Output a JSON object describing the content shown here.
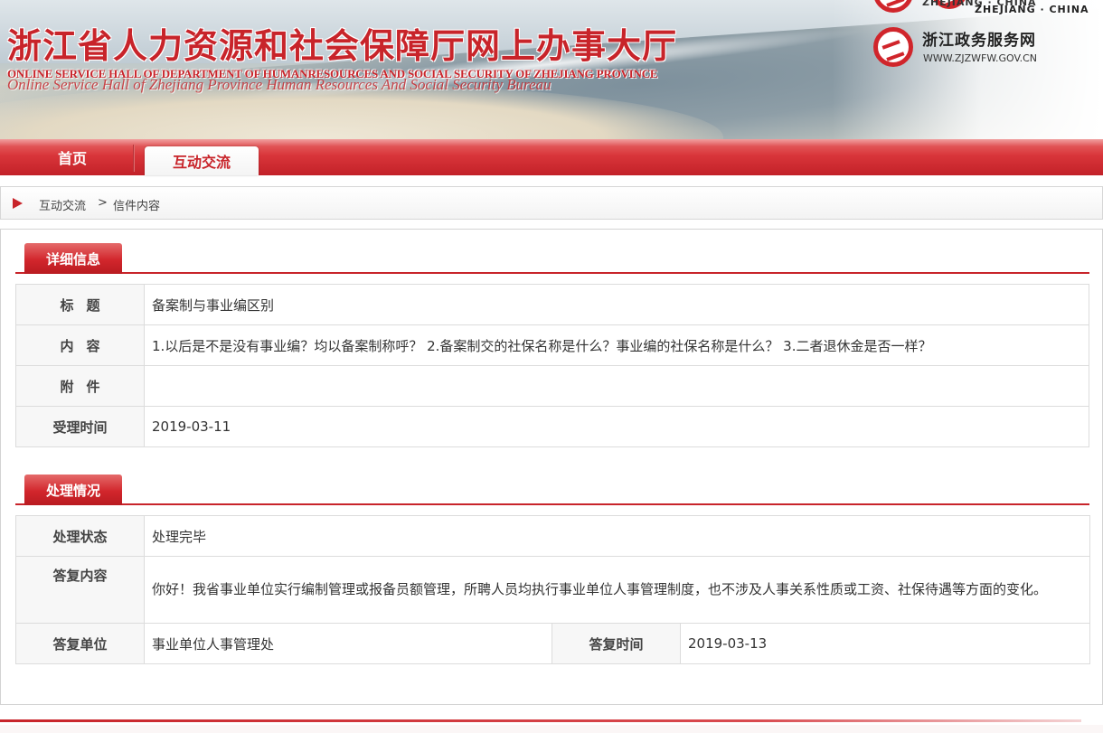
{
  "header": {
    "title": "浙江省人力资源和社会保障厅网上办事大厅",
    "subtitle": "ONLINE SERVICE HALL OF DEPARTMENT OF HUMANRESOURCES AND SOCIAL SECURITY OF ZHEJIANG PROVINCE",
    "subtitle_overlay": "Online Service Hall of Zhejiang Province Human Resources And Social Security Bureau",
    "brand_tag_1": "ZHEJIANG · CHINA",
    "brand_tag_2": "ZHEJIANG · CHINA",
    "gov_portal_name": "浙江政务服务网",
    "gov_portal_url": "WWW.ZJZWFW.GOV.CN"
  },
  "nav": {
    "items": [
      {
        "label": "首页",
        "active": false
      },
      {
        "label": "互动交流",
        "active": true
      }
    ]
  },
  "breadcrumb": {
    "items": [
      "互动交流",
      "信件内容"
    ],
    "separator": ">"
  },
  "details": {
    "section_title": "详细信息",
    "rows": [
      {
        "label": "标题",
        "value": "备案制与事业编区别"
      },
      {
        "label": "内容",
        "value": "1.以后是不是没有事业编？均以备案制称呼？ 2.备案制交的社保名称是什么？事业编的社保名称是什么？ 3.二者退休金是否一样？"
      },
      {
        "label": "附件",
        "value": ""
      },
      {
        "label": "受理时间",
        "value": "2019-03-11"
      }
    ]
  },
  "processing": {
    "section_title": "处理情况",
    "status_label": "处理状态",
    "status_value": "处理完毕",
    "reply_label": "答复内容",
    "reply_value": "你好！我省事业单位实行编制管理或报备员额管理，所聘人员均执行事业单位人事管理制度，也不涉及人事关系性质或工资、社保待遇等方面的变化。",
    "unit_label": "答复单位",
    "unit_value": "事业单位人事管理处",
    "time_label": "答复时间",
    "time_value": "2019-03-13"
  },
  "colors": {
    "brand_red": "#c8242a",
    "label_bg": "#f7f7f7",
    "border": "#dcdcdc"
  }
}
